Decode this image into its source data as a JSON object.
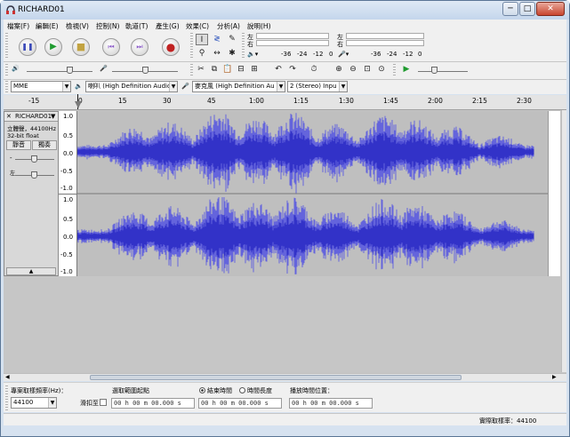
{
  "window": {
    "title": "RICHARD01",
    "minimize": "─",
    "maximize": "□",
    "close": "✕"
  },
  "menu": [
    "檔案(F)",
    "編輯(E)",
    "檢視(V)",
    "控制(N)",
    "軌道(T)",
    "產生(G)",
    "效果(C)",
    "分析(A)",
    "說明(H)"
  ],
  "meter": {
    "left": "左",
    "right": "右",
    "scale_db": [
      "-36",
      "-24",
      "-12",
      "0"
    ]
  },
  "device": {
    "host": "MME",
    "output": "喇叭 (High Definition Audio",
    "input": "麥克風 (High Definition Au",
    "channels": "2 (Stereo) Inpu"
  },
  "ruler": {
    "labels": [
      "-15",
      "0",
      "15",
      "30",
      "45",
      "1:00",
      "1:15",
      "1:30",
      "1:45",
      "2:00",
      "2:15",
      "2:30"
    ]
  },
  "track": {
    "name": "RICHARD01",
    "info": "立體聲，44100Hz",
    "format": "32-bit float",
    "mute": "靜音",
    "solo": "獨奏",
    "scale": [
      "1.0",
      "0.5",
      "0.0",
      "-0.5",
      "-1.0"
    ]
  },
  "bottom": {
    "rate_label": "專案取樣頻率(Hz)：",
    "rate_value": "44100",
    "snap_label": "滑扣至",
    "selection_label": "選取範圍起點",
    "end_label": "結束時間",
    "length_label": "時間長度",
    "position_label": "播放時間位置：",
    "time_value": "00 h 00 m 00.000 s"
  },
  "status": {
    "actual_rate": "實際取樣率：44100"
  },
  "colors": {
    "waveform": "#3232c8",
    "waveform_light": "#6464dc",
    "track_bg": "#bfbfbf"
  }
}
